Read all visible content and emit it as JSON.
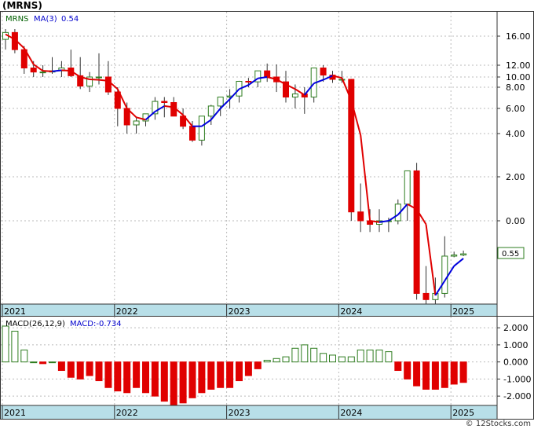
{
  "ticker_title": "(MRNS)",
  "watermark": "© 12Stocks.com",
  "price_panel": {
    "legend_ticker": "MRNS",
    "legend_ma_label": "MA(3)",
    "legend_ma_value": "0.54",
    "last_price_label": "0.55",
    "last_price_value": 0.55,
    "scale": "log",
    "y_tick_labels": [
      "16.00",
      "12.00",
      "10.00",
      "8.00",
      "6.00",
      "4.00",
      "2.00",
      "0.00"
    ],
    "x_tick_labels": [
      "2021",
      "2022",
      "2023",
      "2024",
      "2025"
    ]
  },
  "macd_panel": {
    "legend_label": "MACD(26,12,9)",
    "legend_value_label": "MACD:-0.734",
    "y_tick_labels": [
      "2.000",
      "1.000",
      "0.000",
      "-1.000",
      "-2.000"
    ],
    "x_tick_labels": [
      "2021",
      "2022",
      "2023",
      "2024",
      "2025"
    ],
    "ylim": [
      -2.5,
      2.1
    ]
  },
  "colors": {
    "up_candle": "#2e7d1f",
    "down_candle": "#e00000",
    "ma_up": "#0000dd",
    "ma_down": "#e00000",
    "axis_band": "#b8dfe8",
    "last_price_box": "#2e7d1f",
    "macd_legend": "#0000cc"
  },
  "chart_data": [
    {
      "type": "candlestick",
      "interval": "monthly",
      "scale": "log",
      "x": [
        "2021-01",
        "2021-02",
        "2021-03",
        "2021-04",
        "2021-05",
        "2021-06",
        "2021-07",
        "2021-08",
        "2021-09",
        "2021-10",
        "2021-11",
        "2021-12",
        "2022-01",
        "2022-02",
        "2022-03",
        "2022-04",
        "2022-05",
        "2022-06",
        "2022-07",
        "2022-08",
        "2022-09",
        "2022-10",
        "2022-11",
        "2022-12",
        "2023-01",
        "2023-02",
        "2023-03",
        "2023-04",
        "2023-05",
        "2023-06",
        "2023-07",
        "2023-08",
        "2023-09",
        "2023-10",
        "2023-11",
        "2023-12",
        "2024-01",
        "2024-02",
        "2024-03",
        "2024-04",
        "2024-05",
        "2024-06",
        "2024-07",
        "2024-08",
        "2024-09",
        "2024-10",
        "2024-11",
        "2024-12",
        "2025-01",
        "2025-02"
      ],
      "open": [
        15.5,
        17.0,
        14.0,
        11.5,
        10.8,
        10.8,
        11.0,
        11.5,
        10.2,
        8.2,
        10.0,
        10.0,
        7.5,
        6.0,
        4.6,
        4.9,
        5.5,
        6.6,
        6.5,
        5.3,
        4.5,
        3.6,
        5.3,
        6.2,
        7.0,
        7.1,
        9.1,
        9.0,
        11.0,
        10.0,
        9.0,
        7.0,
        7.3,
        7.0,
        11.5,
        10.3,
        9.5,
        9.5,
        1.15,
        1.0,
        0.95,
        1.0,
        1.0,
        1.3,
        2.2,
        0.35,
        0.32,
        0.35,
        0.6,
        0.61
      ],
      "high": [
        18.0,
        18.0,
        14.5,
        12.5,
        12.0,
        13.0,
        12.5,
        14.0,
        13.0,
        10.8,
        13.5,
        12.5,
        8.0,
        6.5,
        5.2,
        5.5,
        7.0,
        7.0,
        7.0,
        6.0,
        4.9,
        4.4,
        6.3,
        7.0,
        7.8,
        9.2,
        9.8,
        11.0,
        12.2,
        12.1,
        11.0,
        8.5,
        8.0,
        11.5,
        12.0,
        11.0,
        11.0,
        9.6,
        1.8,
        1.2,
        1.2,
        1.05,
        1.4,
        2.2,
        2.5,
        0.52,
        0.44,
        0.8,
        0.64,
        0.65
      ],
      "low": [
        14.0,
        13.5,
        10.5,
        10.0,
        10.0,
        10.5,
        10.0,
        10.0,
        7.8,
        7.5,
        8.5,
        7.2,
        4.5,
        4.0,
        4.0,
        4.5,
        5.0,
        5.2,
        5.5,
        4.3,
        3.5,
        3.3,
        4.6,
        5.3,
        6.0,
        6.5,
        8.0,
        8.0,
        9.0,
        7.5,
        6.5,
        6.0,
        5.5,
        6.5,
        9.0,
        8.8,
        8.8,
        1.0,
        0.85,
        0.85,
        0.85,
        0.85,
        0.95,
        1.0,
        0.32,
        0.29,
        0.27,
        0.33,
        0.59,
        0.6
      ],
      "close": [
        17.0,
        14.0,
        11.5,
        10.8,
        10.8,
        11.0,
        11.5,
        10.2,
        8.2,
        10.0,
        10.0,
        7.5,
        6.0,
        4.6,
        4.9,
        5.5,
        6.6,
        6.5,
        5.3,
        4.5,
        3.6,
        5.3,
        6.2,
        7.0,
        7.1,
        9.1,
        9.0,
        11.0,
        10.0,
        9.0,
        7.0,
        7.3,
        7.0,
        11.5,
        10.3,
        9.5,
        9.5,
        1.15,
        1.0,
        0.95,
        1.0,
        1.0,
        1.3,
        2.2,
        0.35,
        0.32,
        0.35,
        0.6,
        0.61,
        0.62
      ],
      "ma3": [
        16.5,
        15.5,
        14.2,
        12.1,
        11.0,
        10.9,
        11.1,
        11.0,
        10.0,
        9.5,
        9.4,
        9.2,
        7.8,
        6.0,
        5.2,
        5.0,
        5.7,
        6.2,
        6.1,
        5.4,
        4.5,
        4.5,
        5.0,
        6.0,
        6.8,
        7.8,
        8.4,
        9.7,
        10.0,
        9.5,
        8.5,
        7.8,
        7.2,
        8.7,
        9.4,
        10.2,
        9.8,
        6.7,
        3.9,
        1.0,
        0.98,
        1.0,
        1.1,
        1.3,
        1.2,
        0.95,
        0.34,
        0.42,
        0.52,
        0.58
      ]
    },
    {
      "type": "bar",
      "title": "MACD(26,12,9)",
      "x": [
        "2021-01",
        "2021-02",
        "2021-03",
        "2021-04",
        "2021-05",
        "2021-06",
        "2021-07",
        "2021-08",
        "2021-09",
        "2021-10",
        "2021-11",
        "2021-12",
        "2022-01",
        "2022-02",
        "2022-03",
        "2022-04",
        "2022-05",
        "2022-06",
        "2022-07",
        "2022-08",
        "2022-09",
        "2022-10",
        "2022-11",
        "2022-12",
        "2023-01",
        "2023-02",
        "2023-03",
        "2023-04",
        "2023-05",
        "2023-06",
        "2023-07",
        "2023-08",
        "2023-09",
        "2023-10",
        "2023-11",
        "2023-12",
        "2024-01",
        "2024-02",
        "2024-03",
        "2024-04",
        "2024-05",
        "2024-06",
        "2024-07",
        "2024-08",
        "2024-09",
        "2024-10",
        "2024-11",
        "2024-12",
        "2025-01",
        "2025-02"
      ],
      "values": [
        2.1,
        1.8,
        0.7,
        0.0,
        -0.1,
        0.0,
        -0.5,
        -0.9,
        -1.0,
        -0.8,
        -1.1,
        -1.5,
        -1.7,
        -1.8,
        -1.5,
        -1.8,
        -2.0,
        -2.3,
        -2.5,
        -2.4,
        -2.1,
        -1.8,
        -1.6,
        -1.5,
        -1.5,
        -1.1,
        -0.8,
        -0.4,
        0.1,
        0.2,
        0.3,
        0.8,
        1.0,
        0.8,
        0.5,
        0.4,
        0.3,
        0.3,
        0.7,
        0.7,
        0.7,
        0.6,
        -0.5,
        -1.0,
        -1.4,
        -1.6,
        -1.6,
        -1.5,
        -1.3,
        -1.2
      ],
      "ylim": [
        -2.5,
        2.1
      ]
    }
  ]
}
